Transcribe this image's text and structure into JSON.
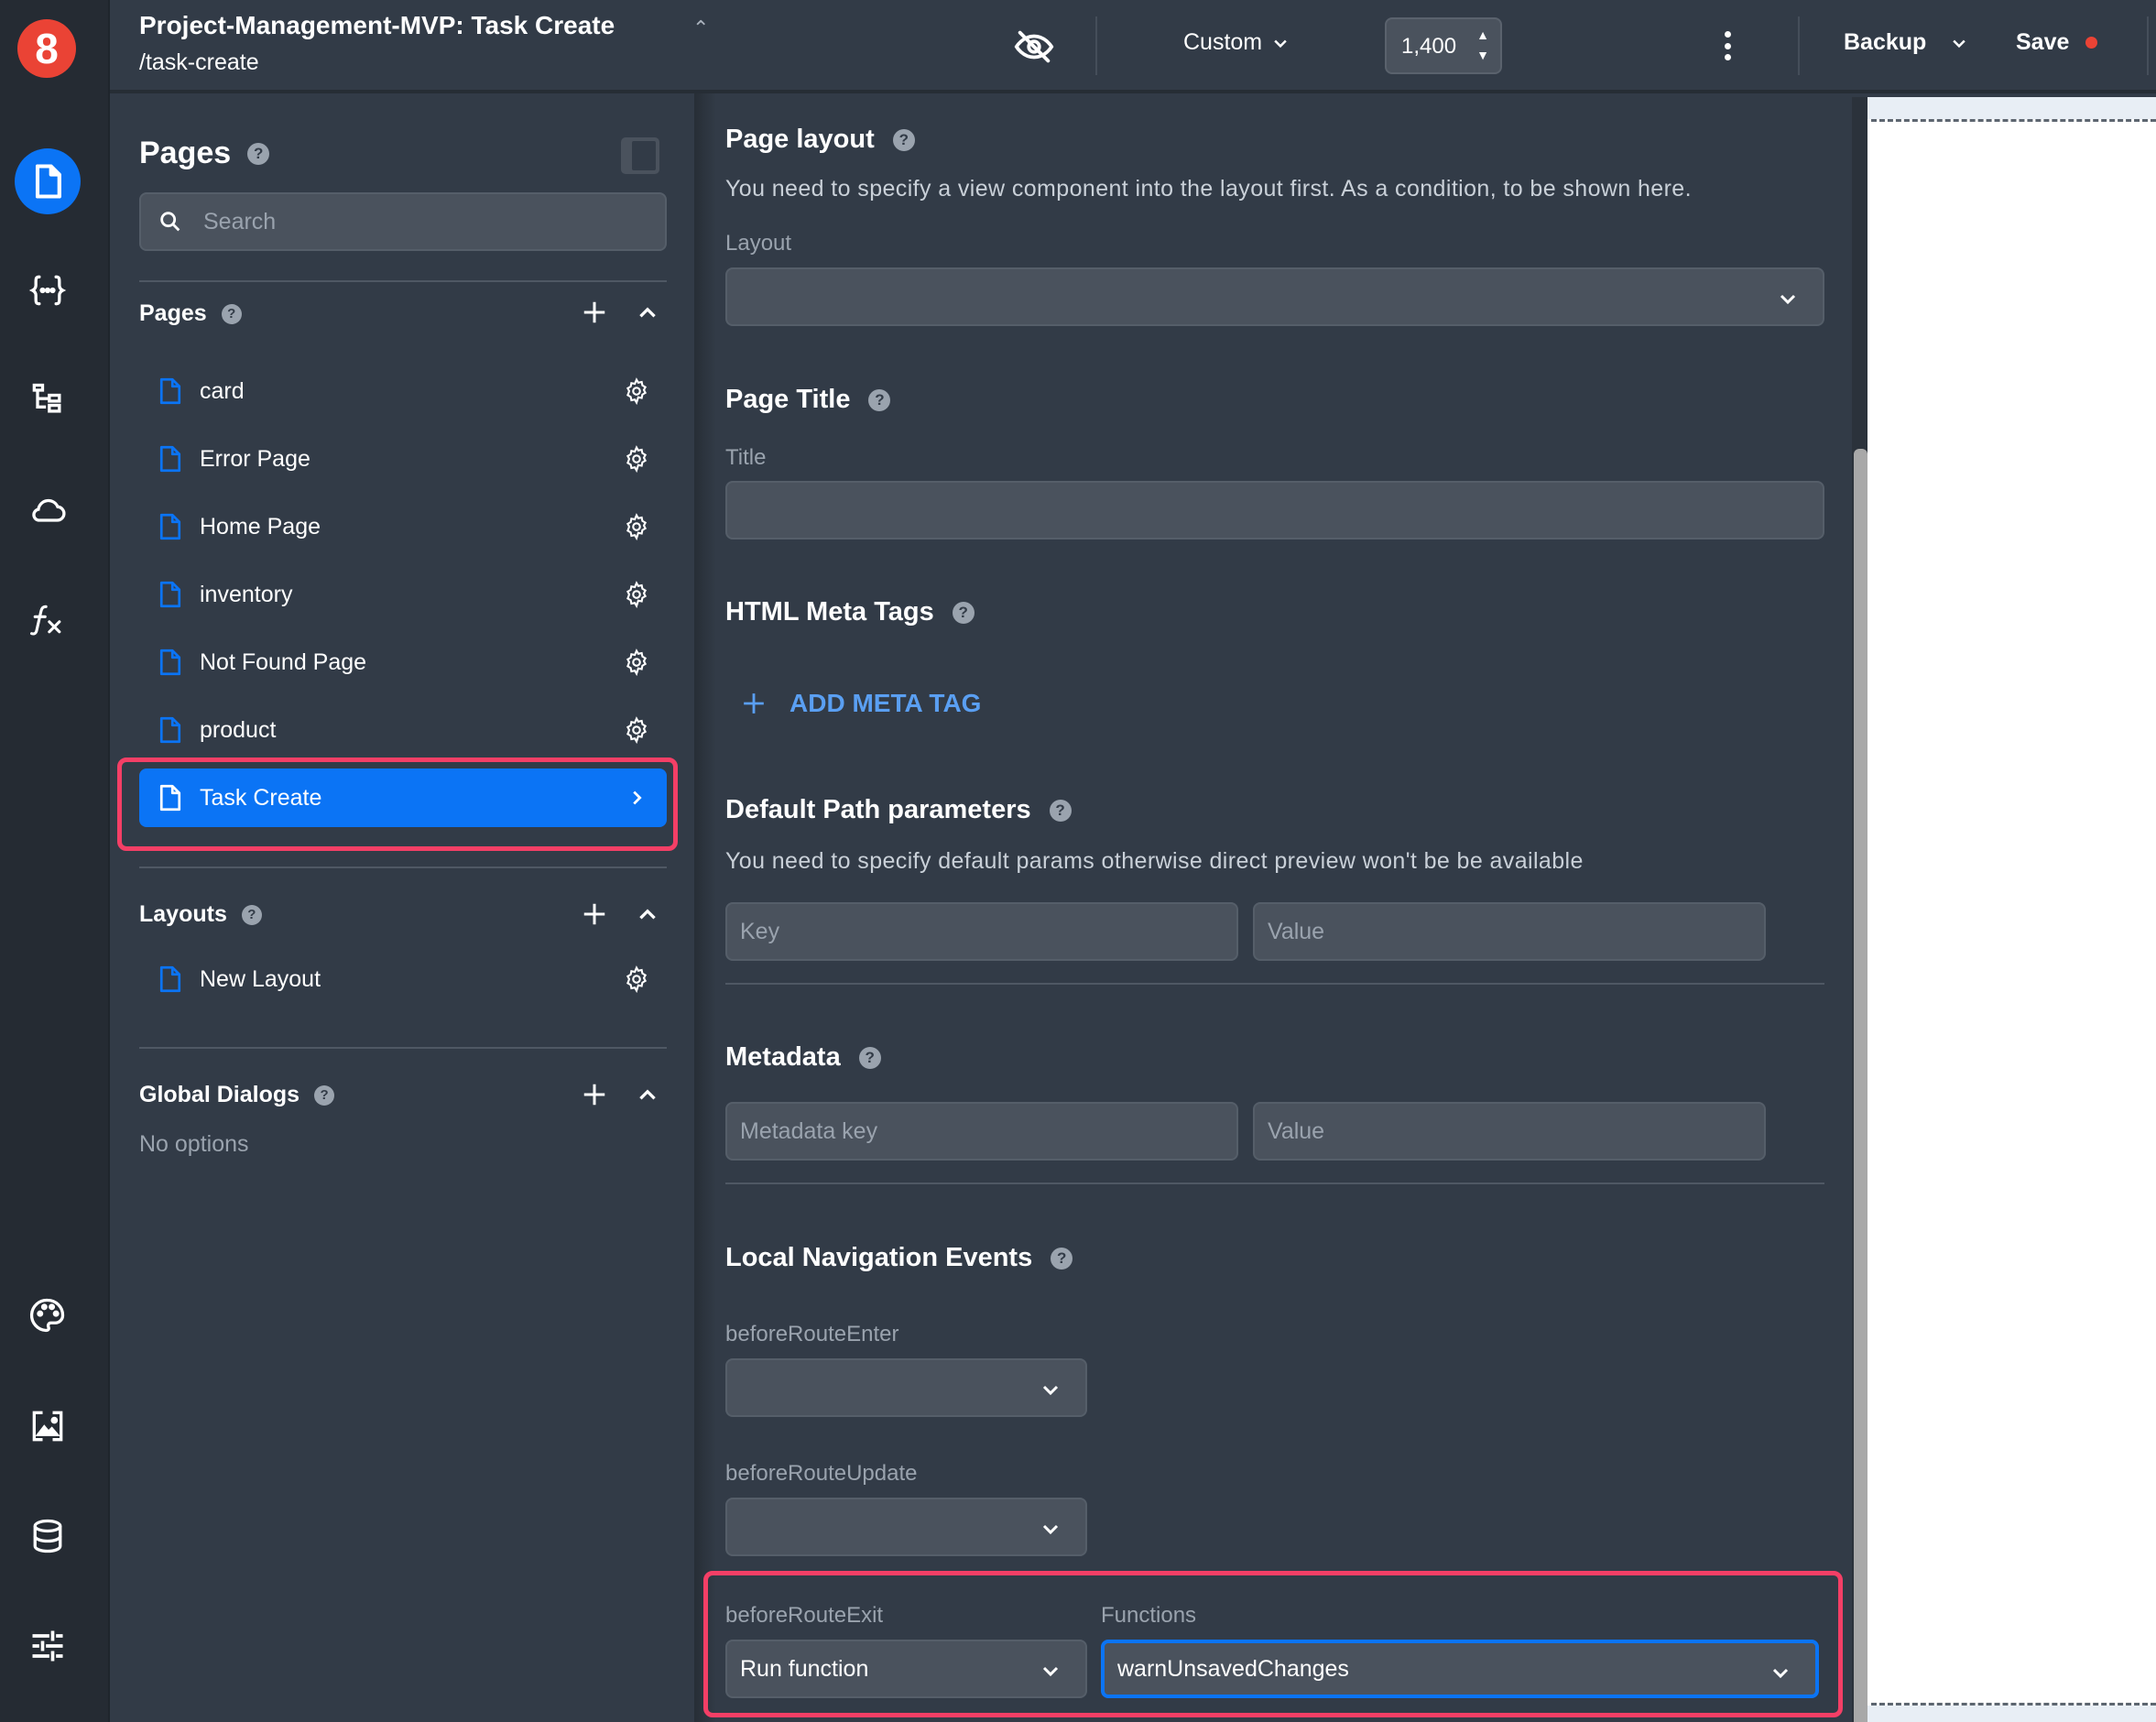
{
  "app": {
    "logo_text": "8",
    "title": "Project-Management-MVP: Task Create",
    "route": "/task-create"
  },
  "rail": {
    "items": [
      {
        "icon": "page-icon",
        "active": true
      },
      {
        "icon": "variables-braces-icon"
      },
      {
        "icon": "component-tree-icon"
      },
      {
        "icon": "cloud-icon"
      },
      {
        "icon": "function-fx-icon"
      },
      {
        "icon": "palette-icon"
      },
      {
        "icon": "image-assets-icon"
      },
      {
        "icon": "database-icon"
      },
      {
        "icon": "settings-sliders-icon"
      }
    ]
  },
  "toolbar": {
    "preview_toggle_icon": "eye-off-icon",
    "device_preset": "Custom",
    "width_value": "1,400",
    "backup_label": "Backup",
    "save_label": "Save",
    "unsaved_indicator_color": "#ea4335"
  },
  "pages_panel": {
    "title": "Pages",
    "search_placeholder": "Search",
    "sections": {
      "pages": {
        "title": "Pages",
        "items": [
          "card",
          "Error Page",
          "Home Page",
          "inventory",
          "Not Found Page",
          "product",
          "Task Create"
        ],
        "selected": "Task Create"
      },
      "layouts": {
        "title": "Layouts",
        "items": [
          "New Layout"
        ]
      },
      "global_dialogs": {
        "title": "Global Dialogs",
        "empty_text": "No options"
      }
    }
  },
  "settings": {
    "page_layout": {
      "title": "Page layout",
      "description": "You need to specify a view component into the layout first. As a condition, to be shown here.",
      "layout_label": "Layout",
      "layout_value": ""
    },
    "page_title": {
      "title": "Page Title",
      "title_label": "Title",
      "title_value": ""
    },
    "meta_tags": {
      "title": "HTML Meta Tags",
      "add_label": "ADD META TAG"
    },
    "path_params": {
      "title": "Default Path parameters",
      "description": "You need to specify default params otherwise direct preview won't be be available",
      "key_placeholder": "Key",
      "value_placeholder": "Value"
    },
    "metadata": {
      "title": "Metadata",
      "key_placeholder": "Metadata key",
      "value_placeholder": "Value"
    },
    "navigation_events": {
      "title": "Local Navigation Events",
      "before_route_enter_label": "beforeRouteEnter",
      "before_route_enter_value": "",
      "before_route_update_label": "beforeRouteUpdate",
      "before_route_update_value": "",
      "before_route_exit_label": "beforeRouteExit",
      "before_route_exit_value": "Run function",
      "functions_label": "Functions",
      "functions_value": "warnUnsavedChanges"
    }
  },
  "colors": {
    "accent": "#0b74f5",
    "highlight": "#f43f66",
    "link": "#5a9ff2",
    "logo": "#ea4335"
  }
}
